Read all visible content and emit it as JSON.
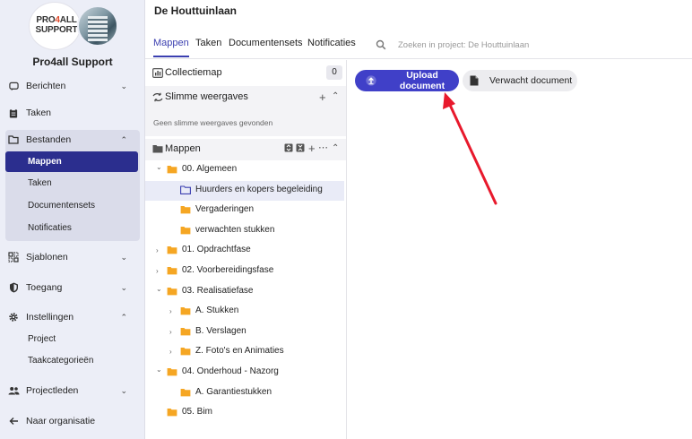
{
  "brand": {
    "logo_line1": "PRO",
    "logo_accent": "4",
    "logo_line1b": "ALL",
    "logo_line2": "SUPPORT",
    "org_name": "Pro4all Support"
  },
  "sidebar": {
    "items": [
      {
        "label": "Berichten",
        "icon": "chat-icon",
        "chevron": "down"
      },
      {
        "label": "Taken",
        "icon": "clipboard-icon"
      },
      {
        "label": "Bestanden",
        "icon": "folder-icon",
        "chevron": "up"
      },
      {
        "label": "Sjablonen",
        "icon": "template-icon",
        "chevron": "down"
      },
      {
        "label": "Toegang",
        "icon": "shield-icon",
        "chevron": "down"
      },
      {
        "label": "Instellingen",
        "icon": "gear-icon",
        "chevron": "up"
      },
      {
        "label": "Projectleden",
        "icon": "people-icon",
        "chevron": "down"
      },
      {
        "label": "Naar organisatie",
        "icon": "arrow-left-icon"
      }
    ],
    "bestanden_sub": [
      "Mappen",
      "Taken",
      "Documentensets",
      "Notificaties"
    ],
    "instellingen_sub": [
      "Project",
      "Taakcategorieën"
    ]
  },
  "header": {
    "project_title": "De Houttuinlaan",
    "tabs": [
      "Mappen",
      "Taken",
      "Documentensets",
      "Notificaties"
    ],
    "search_placeholder": "Zoeken in project: De Houttuinlaan"
  },
  "panel": {
    "collectiemap_label": "Collectiemap",
    "collectiemap_count": "0",
    "smart_views_label": "Slimme weergaves",
    "smart_views_empty": "Geen slimme weergaves gevonden",
    "folders_label": "Mappen"
  },
  "tree": [
    {
      "label": "00. Algemeen",
      "depth": 0,
      "expanded": true
    },
    {
      "label": "Huurders en kopers begeleiding",
      "depth": 1,
      "selected": true,
      "outline": true
    },
    {
      "label": "Vergaderingen",
      "depth": 1
    },
    {
      "label": "verwachten stukken",
      "depth": 1
    },
    {
      "label": "01. Opdrachtfase",
      "depth": 0,
      "expanded": false
    },
    {
      "label": "02. Voorbereidingsfase",
      "depth": 0,
      "expanded": false
    },
    {
      "label": "03. Realisatiefase",
      "depth": 0,
      "expanded": true
    },
    {
      "label": "A. Stukken",
      "depth": 1,
      "expanded": false
    },
    {
      "label": "B. Verslagen",
      "depth": 1,
      "expanded": false
    },
    {
      "label": "Z. Foto's en Animaties",
      "depth": 1,
      "expanded": false
    },
    {
      "label": "04. Onderhoud - Nazorg",
      "depth": 0,
      "expanded": true
    },
    {
      "label": "A. Garantiestukken",
      "depth": 1
    },
    {
      "label": "05. Bim",
      "depth": 0
    }
  ],
  "actions": {
    "upload_label": "Upload document",
    "expected_label": "Verwacht document"
  },
  "colors": {
    "primary": "#4040c8",
    "active_nav": "#2b2e8e",
    "folder": "#f5a623",
    "annotation_arrow": "#e8192c"
  }
}
